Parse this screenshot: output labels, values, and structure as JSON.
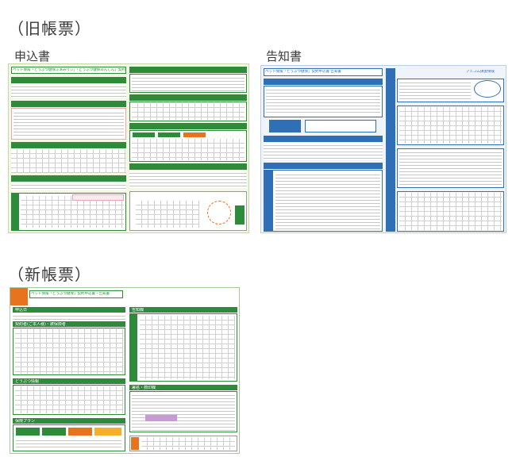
{
  "old_section": {
    "heading": "（旧帳票）"
  },
  "application_form": {
    "label": "申込書",
    "title": "ペット保険「どうぶつ健保ふぁみりぃ」「どうぶつ健保あんしん」契約申込書",
    "colors": {
      "primary": "#2e8b3a",
      "pink": "#e9a6b8",
      "bg": "#f3f8e4"
    }
  },
  "notice_form": {
    "label": "告知書",
    "title": "ペット保険「どうぶつ健保」契約申込書 告知書",
    "company": "アニコム損害保険",
    "colors": {
      "primary": "#2e6fb5",
      "bg": "#eef4fa"
    }
  },
  "new_section": {
    "heading": "（新帳票）"
  },
  "new_form": {
    "title": "ペット保険「どうぶつ健保」契約申込書・告知書",
    "sections": [
      {
        "num": "1",
        "label": "申込日"
      },
      {
        "num": "2",
        "label": "契約者(ご本人様)・被保険者"
      },
      {
        "num": "3",
        "label": "どうぶつ情報"
      },
      {
        "num": "4",
        "label": "保険プラン"
      },
      {
        "num": "5",
        "label": "告知欄"
      },
      {
        "num": "6",
        "label": "署名・捺印欄"
      }
    ],
    "colors": {
      "primary": "#2e8b3a",
      "orange": "#e8731f"
    }
  }
}
